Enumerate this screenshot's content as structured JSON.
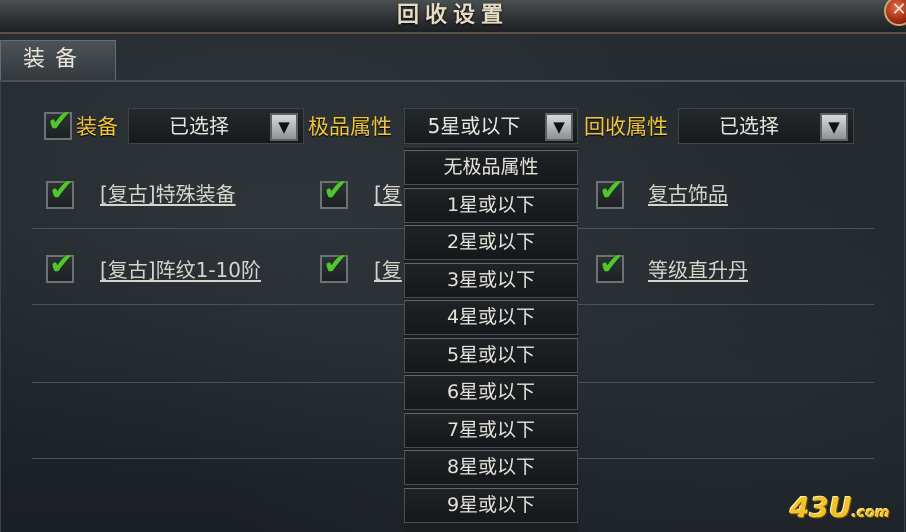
{
  "window": {
    "title": "回收设置",
    "close_glyph": "✕"
  },
  "tabs": [
    {
      "label": "装备"
    }
  ],
  "filters": {
    "equip_label": "装备",
    "equip_value": "已选择",
    "quality_label": "极品属性",
    "quality_value": "5星或以下",
    "recycle_label": "回收属性",
    "recycle_value": "已选择"
  },
  "items": [
    {
      "label": "[复古]特殊装备",
      "checked": true
    },
    {
      "label": "[复",
      "checked": true
    },
    {
      "label": "复古饰品",
      "checked": true
    },
    {
      "label": "[复古]阵纹1-10阶",
      "checked": true
    },
    {
      "label": "[复",
      "checked": true
    },
    {
      "label": "等级直升丹",
      "checked": true
    }
  ],
  "dropdown_options": [
    "无极品属性",
    "1星或以下",
    "2星或以下",
    "3星或以下",
    "4星或以下",
    "5星或以下",
    "6星或以下",
    "7星或以下",
    "8星或以下",
    "9星或以下"
  ],
  "icons": {
    "check": "✔",
    "dropdown_arrow": "▼"
  },
  "colors": {
    "accent_yellow": "#f2c53a",
    "check_green": "#52c52e",
    "close_red": "#9b2411"
  },
  "watermark": {
    "main": "43U",
    "suffix": ".com"
  }
}
